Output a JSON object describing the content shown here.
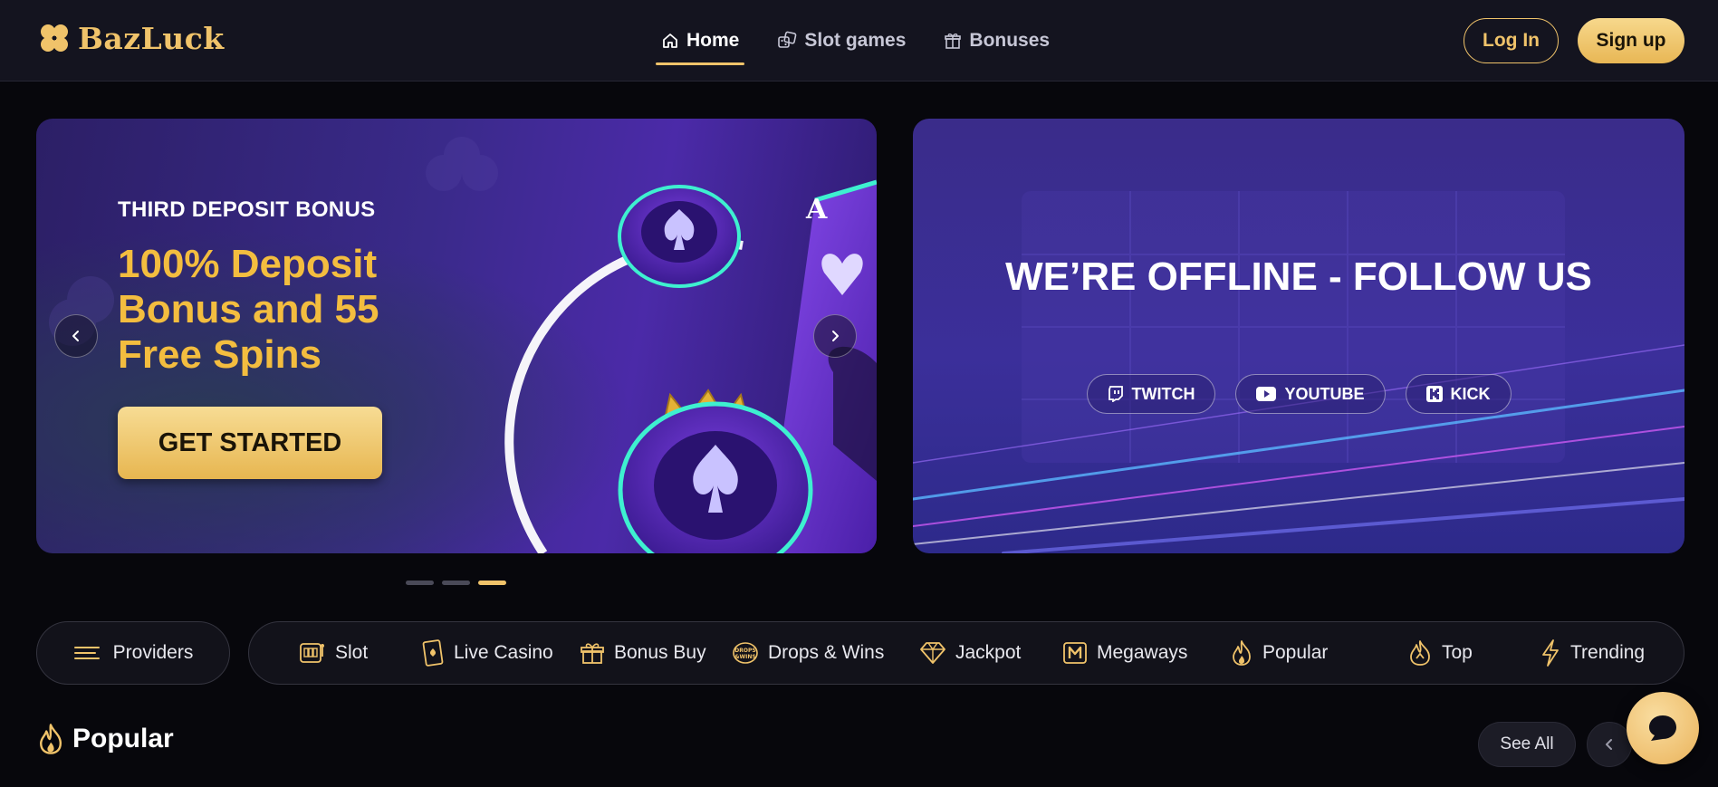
{
  "header": {
    "logo_text": "BazLuck",
    "nav": [
      {
        "label": "Home",
        "icon": "home-icon",
        "active": true
      },
      {
        "label": "Slot games",
        "icon": "dice-icon",
        "active": false
      },
      {
        "label": "Bonuses",
        "icon": "gift-icon",
        "active": false
      }
    ],
    "login_label": "Log In",
    "signup_label": "Sign up"
  },
  "hero": {
    "slide": {
      "eyebrow": "THIRD DEPOSIT BONUS",
      "title": "100% Deposit Bonus and 55 Free Spins",
      "cta": "GET STARTED"
    },
    "dots": {
      "count": 3,
      "active_index": 2
    }
  },
  "stream": {
    "title": "WE’RE OFFLINE - FOLLOW US",
    "links": [
      {
        "label": "TWITCH",
        "icon": "twitch-icon"
      },
      {
        "label": "YOUTUBE",
        "icon": "youtube-icon"
      },
      {
        "label": "KICK",
        "icon": "kick-icon"
      }
    ]
  },
  "categories": {
    "providers_label": "Providers",
    "items": [
      {
        "label": "Slot",
        "icon": "slot-machine-icon"
      },
      {
        "label": "Live Casino",
        "icon": "playing-card-icon"
      },
      {
        "label": "Bonus Buy",
        "icon": "gift-box-icon"
      },
      {
        "label": "Drops & Wins",
        "icon": "drops-wins-badge-icon"
      },
      {
        "label": "Jackpot",
        "icon": "diamond-icon"
      },
      {
        "label": "Megaways",
        "icon": "megaways-m-icon"
      },
      {
        "label": "Popular",
        "icon": "flame-icon"
      },
      {
        "label": "Top",
        "icon": "top-icon"
      },
      {
        "label": "Trending",
        "icon": "lightning-icon"
      }
    ]
  },
  "popular": {
    "title": "Popular",
    "see_all": "See All"
  },
  "colors": {
    "accent_gold": "#f0c36a",
    "header_bg": "#14141f",
    "page_bg": "#07070c"
  }
}
